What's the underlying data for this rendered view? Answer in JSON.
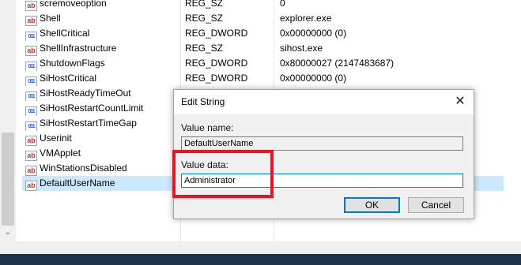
{
  "registry": {
    "rows": [
      {
        "name": "scremoveoption",
        "type": "REG_SZ",
        "data": "0",
        "icon": "string-value-icon"
      },
      {
        "name": "Shell",
        "type": "REG_SZ",
        "data": "explorer.exe",
        "icon": "string-value-icon"
      },
      {
        "name": "ShellCritical",
        "type": "REG_DWORD",
        "data": "0x00000000 (0)",
        "icon": "dword-value-icon"
      },
      {
        "name": "ShellInfrastructure",
        "type": "REG_SZ",
        "data": "sihost.exe",
        "icon": "string-value-icon"
      },
      {
        "name": "ShutdownFlags",
        "type": "REG_DWORD",
        "data": "0x80000027 (2147483687)",
        "icon": "dword-value-icon"
      },
      {
        "name": "SiHostCritical",
        "type": "REG_DWORD",
        "data": "0x00000000 (0)",
        "icon": "dword-value-icon"
      },
      {
        "name": "SiHostReadyTimeOut",
        "type": "",
        "data": "",
        "icon": "dword-value-icon"
      },
      {
        "name": "SiHostRestartCountLimit",
        "type": "",
        "data": "",
        "icon": "dword-value-icon"
      },
      {
        "name": "SiHostRestartTimeGap",
        "type": "",
        "data": "",
        "icon": "dword-value-icon"
      },
      {
        "name": "Userinit",
        "type": "",
        "data": "",
        "icon": "string-value-icon"
      },
      {
        "name": "VMApplet",
        "type": "",
        "data": "",
        "icon": "string-value-icon"
      },
      {
        "name": "WinStationsDisabled",
        "type": "",
        "data": "",
        "icon": "string-value-icon"
      },
      {
        "name": "DefaultUserName",
        "type": "",
        "data": "",
        "icon": "string-value-icon",
        "selected": true
      }
    ]
  },
  "dialog": {
    "title": "Edit String",
    "close_label": "✕",
    "value_name_label": "Value name:",
    "value_name": "DefaultUserName",
    "value_data_label": "Value data:",
    "value_data": "Administrator",
    "ok_label": "OK",
    "cancel_label": "Cancel"
  },
  "colors": {
    "highlight": "#e8141f",
    "selection": "#cce8ff",
    "accent": "#0078d7"
  }
}
